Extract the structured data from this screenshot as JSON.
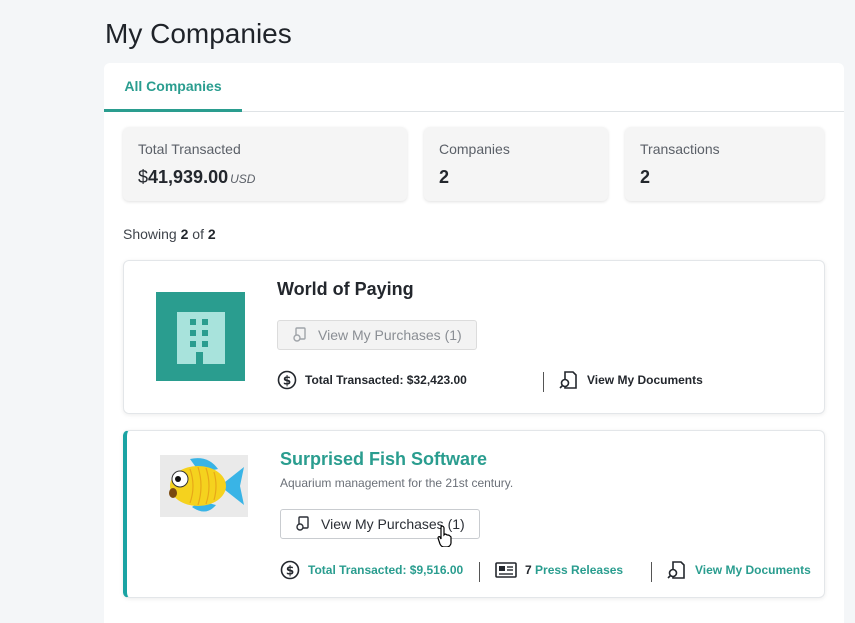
{
  "page": {
    "title": "My Companies"
  },
  "tabs": [
    {
      "label": "All Companies",
      "active": true
    }
  ],
  "stats": {
    "total_transacted": {
      "label": "Total Transacted",
      "currency_symbol": "$",
      "value": "41,939.00",
      "unit": "USD"
    },
    "companies": {
      "label": "Companies",
      "value": "2"
    },
    "transactions": {
      "label": "Transactions",
      "value": "2"
    }
  },
  "showing": {
    "prefix": "Showing",
    "count": "2",
    "of": "of",
    "total": "2"
  },
  "companies": [
    {
      "name": "World of Paying",
      "logo_icon": "building-icon",
      "logo_bg": "#2a9d8f",
      "purchases_label": "View My Purchases (1)",
      "purchases_enabled": false,
      "total_transacted": "Total Transacted: $32,423.00",
      "documents_label": "View My Documents"
    },
    {
      "name": "Surprised Fish Software",
      "description": "Aquarium management for the 21st century.",
      "logo_icon": "fish-icon",
      "purchases_label": "View My Purchases (1)",
      "purchases_enabled": true,
      "total_transacted": "Total Transacted: $9,516.00",
      "press_count": "7",
      "press_label": "Press Releases",
      "documents_label": "View My Documents"
    }
  ],
  "colors": {
    "accent": "#2a9d8f",
    "title": "#1f2329"
  }
}
